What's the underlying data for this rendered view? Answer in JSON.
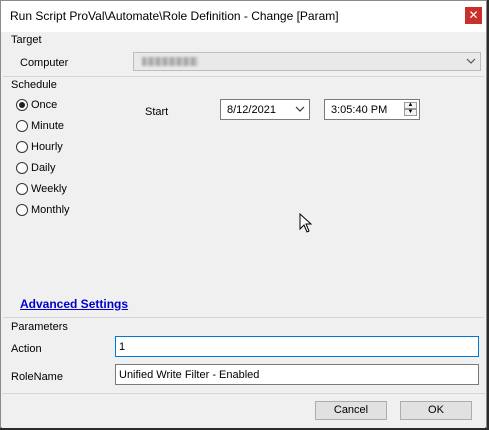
{
  "window": {
    "title": "Run Script ProVal\\Automate\\Role Definition - Change [Param]",
    "close_icon": "close-icon"
  },
  "target": {
    "section_label": "Target",
    "computer_label": "Computer"
  },
  "schedule": {
    "section_label": "Schedule",
    "options": [
      {
        "label": "Once",
        "selected": true
      },
      {
        "label": "Minute",
        "selected": false
      },
      {
        "label": "Hourly",
        "selected": false
      },
      {
        "label": "Daily",
        "selected": false
      },
      {
        "label": "Weekly",
        "selected": false
      },
      {
        "label": "Monthly",
        "selected": false
      }
    ],
    "start_label": "Start",
    "start_date": "8/12/2021",
    "start_time": "3:05:40 PM"
  },
  "advanced_settings_label": "Advanced Settings",
  "parameters": {
    "section_label": "Parameters",
    "action_label": "Action",
    "action_value": "1",
    "rolename_label": "RoleName",
    "rolename_value": "Unified Write Filter - Enabled"
  },
  "buttons": {
    "cancel": "Cancel",
    "ok": "OK"
  },
  "colors": {
    "close_button": "#c9302c",
    "link": "#0000cc",
    "focus_border": "#0078d7"
  }
}
